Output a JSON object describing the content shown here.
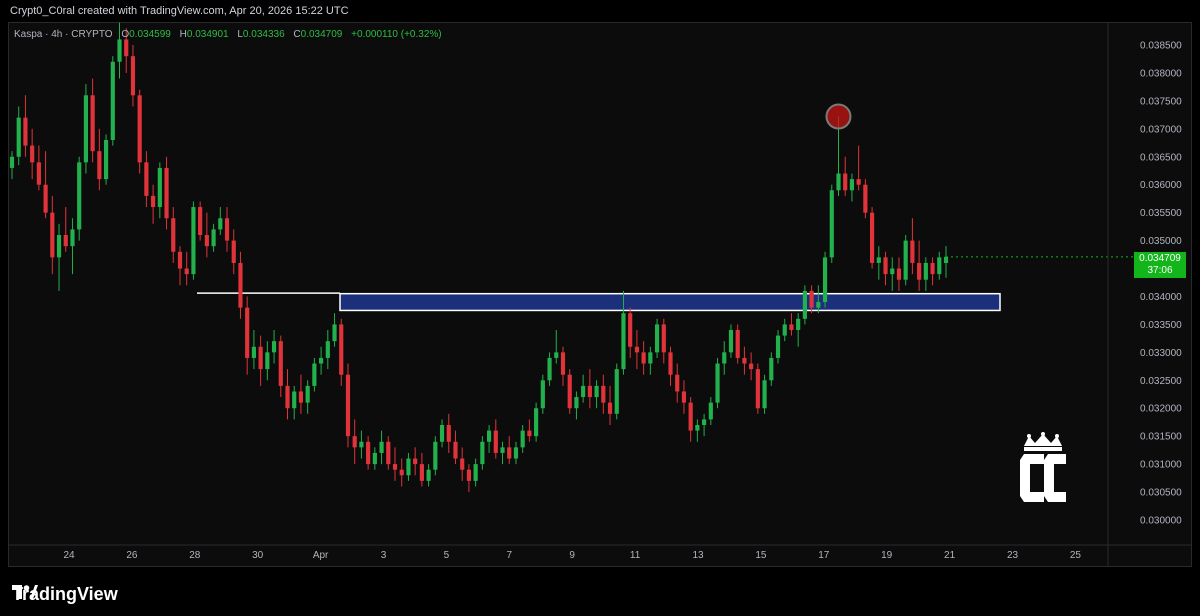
{
  "header": {
    "attribution": "Crypt0_C0ral created with TradingView.com, Apr 20, 2026 15:22 UTC"
  },
  "legend": {
    "symbol": "Kaspa · 4h · CRYPTO",
    "o_label": "O",
    "o": "0.034599",
    "h_label": "H",
    "h": "0.034901",
    "l_label": "L",
    "l": "0.034336",
    "c_label": "C",
    "c": "0.034709",
    "change": "+0.000110 (+0.32%)"
  },
  "price_tag": {
    "price": "0.034709",
    "countdown": "37:06"
  },
  "brand": {
    "name": "TradingView"
  },
  "colors": {
    "up": "#22b14c",
    "down": "#e0343a",
    "zone": "#1c2f7a",
    "tag": "#12b51a"
  },
  "chart_data": {
    "type": "candlestick",
    "symbol": "Kaspa",
    "interval": "4h",
    "y_ticks": [
      "0.038500",
      "0.038000",
      "0.037500",
      "0.037000",
      "0.036500",
      "0.036000",
      "0.035500",
      "0.035000",
      "0.034500",
      "0.034000",
      "0.033500",
      "0.033000",
      "0.032500",
      "0.032000",
      "0.031500",
      "0.031000",
      "0.030500",
      "0.030000"
    ],
    "x_ticks": [
      "24",
      "26",
      "28",
      "30",
      "Apr",
      "3",
      "5",
      "7",
      "9",
      "11",
      "13",
      "15",
      "17",
      "19",
      "21",
      "23",
      "25"
    ],
    "ylim": [
      0.02975,
      0.0389
    ],
    "last_close": 0.034709,
    "zone": {
      "low": 0.03375,
      "high": 0.03405
    },
    "support_line": 0.03406,
    "highlight_high": 0.03722,
    "candles": [
      [
        0.0363,
        0.0366,
        0.0361,
        0.0365
      ],
      [
        0.0365,
        0.0374,
        0.03635,
        0.0372
      ],
      [
        0.0372,
        0.0376,
        0.0365,
        0.0367
      ],
      [
        0.0367,
        0.037,
        0.0361,
        0.0364
      ],
      [
        0.0364,
        0.0367,
        0.0359,
        0.036
      ],
      [
        0.036,
        0.0366,
        0.0354,
        0.0355
      ],
      [
        0.0355,
        0.0358,
        0.0344,
        0.0347
      ],
      [
        0.0347,
        0.0353,
        0.0341,
        0.0351
      ],
      [
        0.0351,
        0.0356,
        0.0348,
        0.0349
      ],
      [
        0.0349,
        0.0354,
        0.0344,
        0.0352
      ],
      [
        0.0352,
        0.0365,
        0.035,
        0.0364
      ],
      [
        0.0364,
        0.0378,
        0.0362,
        0.0376
      ],
      [
        0.0376,
        0.0379,
        0.0364,
        0.0366
      ],
      [
        0.0366,
        0.037,
        0.0359,
        0.0361
      ],
      [
        0.0361,
        0.0369,
        0.036,
        0.0368
      ],
      [
        0.0368,
        0.0383,
        0.0367,
        0.0382
      ],
      [
        0.0382,
        0.0389,
        0.0379,
        0.0386
      ],
      [
        0.0386,
        0.0388,
        0.038,
        0.0383
      ],
      [
        0.0383,
        0.0385,
        0.0374,
        0.0376
      ],
      [
        0.0376,
        0.0377,
        0.0362,
        0.0364
      ],
      [
        0.0364,
        0.0366,
        0.0356,
        0.0358
      ],
      [
        0.0358,
        0.036,
        0.0353,
        0.0356
      ],
      [
        0.0356,
        0.0364,
        0.0354,
        0.0363
      ],
      [
        0.0363,
        0.0365,
        0.0352,
        0.0354
      ],
      [
        0.0354,
        0.0356,
        0.0346,
        0.0348
      ],
      [
        0.0348,
        0.0349,
        0.0342,
        0.0345
      ],
      [
        0.0345,
        0.0348,
        0.0342,
        0.0344
      ],
      [
        0.0344,
        0.0357,
        0.0343,
        0.0356
      ],
      [
        0.0356,
        0.0357,
        0.035,
        0.0351
      ],
      [
        0.0351,
        0.0355,
        0.0347,
        0.0349
      ],
      [
        0.0349,
        0.0353,
        0.0348,
        0.0352
      ],
      [
        0.0352,
        0.0356,
        0.0351,
        0.0354
      ],
      [
        0.0354,
        0.0356,
        0.0348,
        0.035
      ],
      [
        0.035,
        0.0352,
        0.0344,
        0.0346
      ],
      [
        0.0346,
        0.0348,
        0.0336,
        0.0338
      ],
      [
        0.0338,
        0.034,
        0.0326,
        0.0329
      ],
      [
        0.0329,
        0.0334,
        0.0327,
        0.0331
      ],
      [
        0.0331,
        0.0333,
        0.0324,
        0.0327
      ],
      [
        0.0327,
        0.0332,
        0.0325,
        0.033
      ],
      [
        0.033,
        0.0334,
        0.0328,
        0.0332
      ],
      [
        0.0332,
        0.0333,
        0.0322,
        0.0324
      ],
      [
        0.0324,
        0.0327,
        0.0318,
        0.032
      ],
      [
        0.032,
        0.0324,
        0.0318,
        0.0323
      ],
      [
        0.0323,
        0.0326,
        0.0319,
        0.0321
      ],
      [
        0.0321,
        0.0325,
        0.0319,
        0.0324
      ],
      [
        0.0324,
        0.0329,
        0.0323,
        0.0328
      ],
      [
        0.0328,
        0.0331,
        0.0326,
        0.0329
      ],
      [
        0.0329,
        0.0334,
        0.0327,
        0.0332
      ],
      [
        0.0332,
        0.0337,
        0.0331,
        0.0335
      ],
      [
        0.0335,
        0.0336,
        0.0324,
        0.0326
      ],
      [
        0.0326,
        0.0328,
        0.0313,
        0.0315
      ],
      [
        0.0315,
        0.0318,
        0.031,
        0.0313
      ],
      [
        0.0313,
        0.0316,
        0.0311,
        0.0314
      ],
      [
        0.0314,
        0.0315,
        0.0309,
        0.031
      ],
      [
        0.031,
        0.0313,
        0.0309,
        0.0312
      ],
      [
        0.0312,
        0.0316,
        0.031,
        0.0314
      ],
      [
        0.0314,
        0.0315,
        0.0309,
        0.031
      ],
      [
        0.031,
        0.0313,
        0.0307,
        0.0309
      ],
      [
        0.0309,
        0.0311,
        0.0306,
        0.0308
      ],
      [
        0.0308,
        0.0312,
        0.0307,
        0.0311
      ],
      [
        0.0311,
        0.0313,
        0.0308,
        0.031
      ],
      [
        0.031,
        0.0312,
        0.0306,
        0.0307
      ],
      [
        0.0307,
        0.031,
        0.0306,
        0.0309
      ],
      [
        0.0309,
        0.0315,
        0.0308,
        0.0314
      ],
      [
        0.0314,
        0.0318,
        0.0313,
        0.0317
      ],
      [
        0.0317,
        0.0319,
        0.0312,
        0.0314
      ],
      [
        0.0314,
        0.0316,
        0.031,
        0.0311
      ],
      [
        0.0311,
        0.0313,
        0.0307,
        0.0309
      ],
      [
        0.0309,
        0.031,
        0.0305,
        0.0307
      ],
      [
        0.0307,
        0.0311,
        0.0306,
        0.031
      ],
      [
        0.031,
        0.0315,
        0.0309,
        0.0314
      ],
      [
        0.0314,
        0.0317,
        0.0312,
        0.0316
      ],
      [
        0.0316,
        0.0318,
        0.0311,
        0.0312
      ],
      [
        0.0312,
        0.0314,
        0.031,
        0.0313
      ],
      [
        0.0313,
        0.0315,
        0.031,
        0.0311
      ],
      [
        0.0311,
        0.0314,
        0.031,
        0.0313
      ],
      [
        0.0313,
        0.0317,
        0.0312,
        0.0316
      ],
      [
        0.0316,
        0.0318,
        0.0314,
        0.0315
      ],
      [
        0.0315,
        0.0321,
        0.0314,
        0.032
      ],
      [
        0.032,
        0.0326,
        0.0319,
        0.0325
      ],
      [
        0.0325,
        0.033,
        0.0324,
        0.0329
      ],
      [
        0.0329,
        0.0334,
        0.0328,
        0.033
      ],
      [
        0.033,
        0.0331,
        0.0324,
        0.0326
      ],
      [
        0.0326,
        0.0327,
        0.0319,
        0.032
      ],
      [
        0.032,
        0.0323,
        0.0318,
        0.0322
      ],
      [
        0.0322,
        0.0326,
        0.0321,
        0.0324
      ],
      [
        0.0324,
        0.0327,
        0.032,
        0.0322
      ],
      [
        0.0322,
        0.0325,
        0.032,
        0.0324
      ],
      [
        0.0324,
        0.0326,
        0.0319,
        0.0321
      ],
      [
        0.0321,
        0.0324,
        0.0317,
        0.0319
      ],
      [
        0.0319,
        0.0328,
        0.0318,
        0.0327
      ],
      [
        0.0327,
        0.0341,
        0.0326,
        0.0337
      ],
      [
        0.0337,
        0.0338,
        0.0329,
        0.0331
      ],
      [
        0.0331,
        0.0334,
        0.0327,
        0.033
      ],
      [
        0.033,
        0.0332,
        0.0326,
        0.0328
      ],
      [
        0.0328,
        0.0331,
        0.0326,
        0.033
      ],
      [
        0.033,
        0.0336,
        0.0329,
        0.0335
      ],
      [
        0.0335,
        0.0336,
        0.0328,
        0.033
      ],
      [
        0.033,
        0.0331,
        0.0324,
        0.0326
      ],
      [
        0.0326,
        0.0328,
        0.0321,
        0.0323
      ],
      [
        0.0323,
        0.0325,
        0.0319,
        0.0321
      ],
      [
        0.0321,
        0.0322,
        0.0314,
        0.0316
      ],
      [
        0.0316,
        0.0318,
        0.0314,
        0.0317
      ],
      [
        0.0317,
        0.0319,
        0.0315,
        0.0318
      ],
      [
        0.0318,
        0.0322,
        0.0317,
        0.0321
      ],
      [
        0.0321,
        0.0329,
        0.032,
        0.0328
      ],
      [
        0.0328,
        0.0332,
        0.0326,
        0.033
      ],
      [
        0.033,
        0.0335,
        0.0329,
        0.0334
      ],
      [
        0.0334,
        0.0335,
        0.0328,
        0.0329
      ],
      [
        0.0329,
        0.0331,
        0.0326,
        0.0328
      ],
      [
        0.0328,
        0.033,
        0.0325,
        0.0327
      ],
      [
        0.0327,
        0.0328,
        0.0319,
        0.032
      ],
      [
        0.032,
        0.0326,
        0.0319,
        0.0325
      ],
      [
        0.0325,
        0.033,
        0.0324,
        0.0329
      ],
      [
        0.0329,
        0.0334,
        0.0328,
        0.0333
      ],
      [
        0.0333,
        0.0336,
        0.0332,
        0.0335
      ],
      [
        0.0335,
        0.0337,
        0.0333,
        0.0334
      ],
      [
        0.0334,
        0.0337,
        0.0331,
        0.0336
      ],
      [
        0.0336,
        0.0342,
        0.0335,
        0.0341
      ],
      [
        0.0341,
        0.0342,
        0.0337,
        0.0338
      ],
      [
        0.0338,
        0.0342,
        0.0337,
        0.0339
      ],
      [
        0.0339,
        0.0348,
        0.0338,
        0.0347
      ],
      [
        0.0347,
        0.036,
        0.0346,
        0.0359
      ],
      [
        0.0359,
        0.03722,
        0.0358,
        0.0362
      ],
      [
        0.0362,
        0.0365,
        0.0358,
        0.0359
      ],
      [
        0.0359,
        0.0362,
        0.0357,
        0.0361
      ],
      [
        0.0361,
        0.0367,
        0.0359,
        0.036
      ],
      [
        0.036,
        0.0361,
        0.0354,
        0.0355
      ],
      [
        0.0355,
        0.0356,
        0.0345,
        0.0346
      ],
      [
        0.0346,
        0.0349,
        0.0343,
        0.0347
      ],
      [
        0.0347,
        0.0348,
        0.0342,
        0.0344
      ],
      [
        0.0344,
        0.0347,
        0.0341,
        0.0345
      ],
      [
        0.0345,
        0.0347,
        0.0341,
        0.0343
      ],
      [
        0.0343,
        0.0351,
        0.0342,
        0.035
      ],
      [
        0.035,
        0.0354,
        0.0344,
        0.0346
      ],
      [
        0.0346,
        0.035,
        0.0341,
        0.0343
      ],
      [
        0.0343,
        0.0347,
        0.0341,
        0.0346
      ],
      [
        0.0346,
        0.0347,
        0.0342,
        0.0344
      ],
      [
        0.0344,
        0.0348,
        0.0343,
        0.0347
      ],
      [
        0.034599,
        0.034901,
        0.034336,
        0.034709
      ]
    ]
  }
}
